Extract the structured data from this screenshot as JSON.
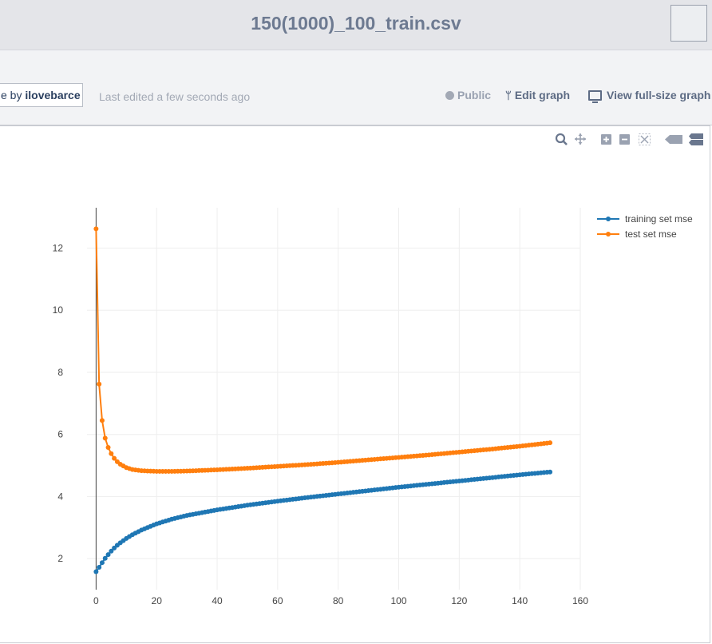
{
  "header": {
    "title": "150(1000)_100_train.csv"
  },
  "meta": {
    "by_prefix": "e by",
    "author": "ilovebarce",
    "last_edited": "Last edited a few seconds ago",
    "public_label": "Public",
    "edit_label": "Edit graph",
    "view_label": "View full-size graph"
  },
  "modebar": {
    "icons": [
      "zoom-icon",
      "pan-icon",
      "zoom-in-icon",
      "zoom-out-icon",
      "autoscale-icon",
      "hover-closest-icon",
      "hover-compare-icon"
    ]
  },
  "colors": {
    "training": "#1f77b4",
    "test": "#ff7f0e",
    "grid": "#eeeeee"
  },
  "chart_data": {
    "type": "line",
    "title": "",
    "xlabel": "",
    "ylabel": "",
    "xlim": [
      -3,
      160
    ],
    "ylim": [
      1,
      13.3
    ],
    "xticks": [
      0,
      20,
      40,
      60,
      80,
      100,
      120,
      140,
      160
    ],
    "yticks": [
      2,
      4,
      6,
      8,
      10,
      12
    ],
    "grid": true,
    "legend_position": "top-right",
    "x": {
      "start": 0,
      "end": 150,
      "step": 1
    },
    "series": [
      {
        "name": "training set mse",
        "color": "#1f77b4",
        "anchors": [
          [
            0,
            1.58
          ],
          [
            1,
            1.72
          ],
          [
            2,
            1.87
          ],
          [
            3,
            2.01
          ],
          [
            4,
            2.13
          ],
          [
            5,
            2.24
          ],
          [
            6,
            2.34
          ],
          [
            7,
            2.43
          ],
          [
            8,
            2.51
          ],
          [
            10,
            2.65
          ],
          [
            12,
            2.77
          ],
          [
            15,
            2.92
          ],
          [
            20,
            3.12
          ],
          [
            25,
            3.27
          ],
          [
            30,
            3.39
          ],
          [
            40,
            3.57
          ],
          [
            50,
            3.72
          ],
          [
            60,
            3.85
          ],
          [
            70,
            3.97
          ],
          [
            80,
            4.08
          ],
          [
            90,
            4.19
          ],
          [
            100,
            4.3
          ],
          [
            110,
            4.4
          ],
          [
            120,
            4.5
          ],
          [
            130,
            4.6
          ],
          [
            140,
            4.7
          ],
          [
            150,
            4.79
          ]
        ]
      },
      {
        "name": "test set mse",
        "color": "#ff7f0e",
        "anchors": [
          [
            0,
            12.62
          ],
          [
            1,
            7.62
          ],
          [
            2,
            6.45
          ],
          [
            3,
            5.88
          ],
          [
            4,
            5.58
          ],
          [
            5,
            5.38
          ],
          [
            6,
            5.23
          ],
          [
            7,
            5.12
          ],
          [
            8,
            5.04
          ],
          [
            10,
            4.93
          ],
          [
            12,
            4.87
          ],
          [
            15,
            4.83
          ],
          [
            20,
            4.81
          ],
          [
            25,
            4.81
          ],
          [
            30,
            4.82
          ],
          [
            40,
            4.86
          ],
          [
            50,
            4.91
          ],
          [
            60,
            4.97
          ],
          [
            70,
            5.03
          ],
          [
            80,
            5.1
          ],
          [
            90,
            5.18
          ],
          [
            100,
            5.26
          ],
          [
            110,
            5.34
          ],
          [
            120,
            5.43
          ],
          [
            130,
            5.52
          ],
          [
            140,
            5.62
          ],
          [
            150,
            5.73
          ]
        ]
      }
    ]
  }
}
